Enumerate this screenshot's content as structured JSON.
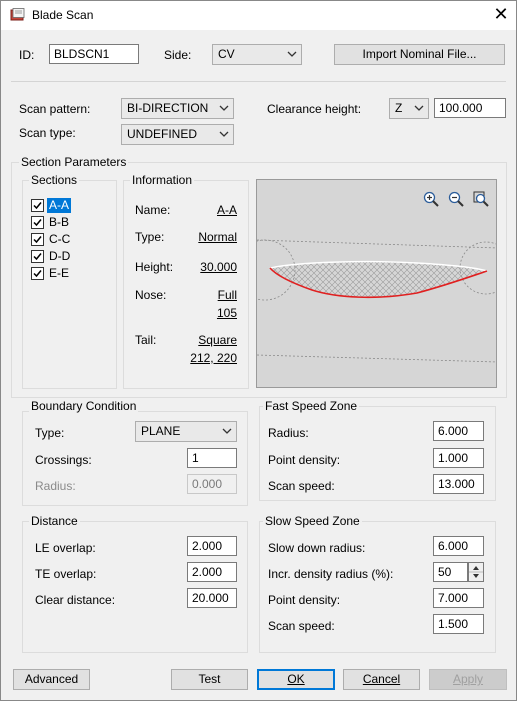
{
  "window": {
    "title": "Blade Scan",
    "close_glyph": "✕"
  },
  "top": {
    "id_label": "ID:",
    "id_value": "BLDSCN1",
    "side_label": "Side:",
    "side_value": "CV",
    "import_button": "Import Nominal File..."
  },
  "scan": {
    "pattern_label": "Scan pattern:",
    "pattern_value": "BI-DIRECTION",
    "type_label": "Scan type:",
    "type_value": "UNDEFINED",
    "clearance_label": "Clearance height:",
    "clearance_axis": "Z",
    "clearance_value": "100.000"
  },
  "section_params": {
    "label": "Section Parameters",
    "sections_label": "Sections",
    "sections": [
      {
        "name": "A-A",
        "checked": true,
        "selected": true
      },
      {
        "name": "B-B",
        "checked": true,
        "selected": false
      },
      {
        "name": "C-C",
        "checked": true,
        "selected": false
      },
      {
        "name": "D-D",
        "checked": true,
        "selected": false
      },
      {
        "name": "E-E",
        "checked": true,
        "selected": false
      }
    ],
    "info_label": "Information",
    "info": {
      "name_label": "Name:",
      "name_value": "A-A",
      "type_label": "Type:",
      "type_value": "Normal",
      "height_label": "Height:",
      "height_value": "30.000",
      "nose_label": "Nose:",
      "nose_value": "Full",
      "nose_value2": "105",
      "tail_label": "Tail:",
      "tail_value": "Square",
      "tail_value2": "212, 220"
    },
    "preview_icons": [
      "zoom-in-icon",
      "zoom-out-icon",
      "zoom-fit-icon"
    ]
  },
  "boundary": {
    "label": "Boundary Condition",
    "type_label": "Type:",
    "type_value": "PLANE",
    "crossings_label": "Crossings:",
    "crossings_value": "1",
    "radius_label": "Radius:",
    "radius_value": "0.000"
  },
  "fast_zone": {
    "label": "Fast Speed Zone",
    "radius_label": "Radius:",
    "radius_value": "6.000",
    "density_label": "Point density:",
    "density_value": "1.000",
    "speed_label": "Scan speed:",
    "speed_value": "13.000"
  },
  "distance": {
    "label": "Distance",
    "le_label": "LE overlap:",
    "le_value": "2.000",
    "te_label": "TE overlap:",
    "te_value": "2.000",
    "clear_label": "Clear distance:",
    "clear_value": "20.000"
  },
  "slow_zone": {
    "label": "Slow Speed Zone",
    "slow_radius_label": "Slow down radius:",
    "slow_radius_value": "6.000",
    "incr_label": "Incr. density radius (%):",
    "incr_value": "50",
    "density_label": "Point density:",
    "density_value": "7.000",
    "speed_label": "Scan speed:",
    "speed_value": "1.500"
  },
  "buttons": {
    "advanced": "Advanced",
    "test": "Test",
    "ok": "OK",
    "cancel": "Cancel",
    "apply": "Apply"
  },
  "colors": {
    "accent": "#0078d7",
    "profile": "#e02020",
    "preview_bg": "#d6d6d6"
  }
}
